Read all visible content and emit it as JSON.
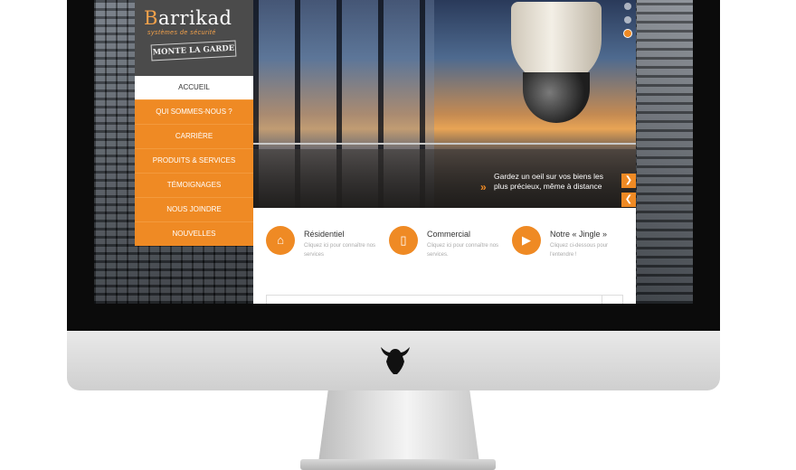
{
  "brand": {
    "name_first": "B",
    "name_rest": "arrikad",
    "tagline": "systèmes de sécurité",
    "badge": "MONTE LA GARDE"
  },
  "menu": {
    "items": [
      {
        "label": "ACCUEIL"
      },
      {
        "label": "QUI SOMMES-NOUS ?"
      },
      {
        "label": "CARRIÈRE"
      },
      {
        "label": "PRODUITS & SERVICES"
      },
      {
        "label": "TÉMOIGNAGES"
      },
      {
        "label": "NOUS JOINDRE"
      },
      {
        "label": "NOUVELLES"
      }
    ]
  },
  "hero": {
    "caption": "Gardez un oeil sur vos biens les plus précieux, même à distance",
    "next_icon": "chevron-right-icon",
    "prev_icon": "chevron-left-icon",
    "slides_total": 3,
    "active_slide": 3
  },
  "services": [
    {
      "title": "Résidentiel",
      "desc": "Cliquez ici pour connaître nos services",
      "icon": "home-icon"
    },
    {
      "title": "Commercial",
      "desc": "Cliquez ici pour connaître nos services.",
      "icon": "tablet-icon"
    },
    {
      "title": "Notre « Jingle »",
      "desc": "Cliquez ci-dessous pour l'entendre !",
      "icon": "play-icon"
    }
  ],
  "colors": {
    "accent": "#ef8a24",
    "sidebar_dark": "#4b4b4b"
  }
}
